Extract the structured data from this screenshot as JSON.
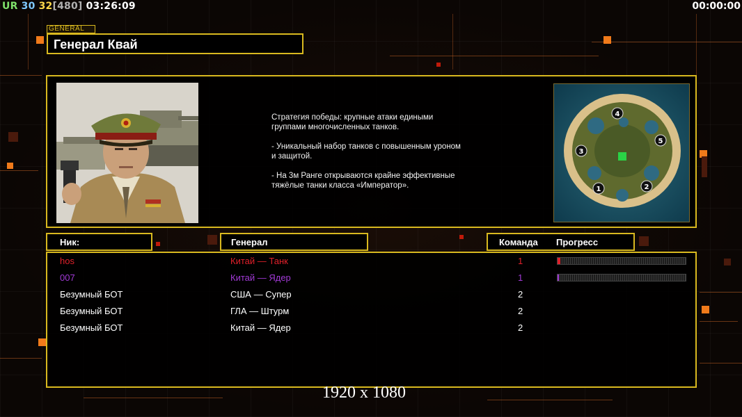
{
  "status": {
    "ur_label": "UR",
    "fps_a": "30",
    "fps_b": "32",
    "fps_c": "[480]",
    "clock": "03:26:09",
    "timer": "00:00:00"
  },
  "general": {
    "tag": "GENERAL",
    "name": "Генерал Квай"
  },
  "strategy": [
    "Стратегия победы: крупные атаки едиными\n группами многочисленных танков.",
    "- Уникальный набор танков с повышенным уроном\n и защитой.",
    "- На 3м Ранге открываются крайне эффективные\n тяжёлые танки класса «Император»."
  ],
  "columns": {
    "nick": "Ник:",
    "general": "Генерал",
    "team": "Команда",
    "progress": "Прогресс"
  },
  "players": [
    {
      "nick": "hos",
      "general": "Китай — Танк",
      "team": "1",
      "color": "#e0202a",
      "progress": 0.02
    },
    {
      "nick": "007",
      "general": "Китай — Ядер",
      "team": "1",
      "color": "#a23ad6",
      "progress": 0.01
    },
    {
      "nick": "Безумный БОТ",
      "general": "США — Супер",
      "team": "2",
      "color": "#ffffff",
      "progress": null
    },
    {
      "nick": "Безумный БОТ",
      "general": "ГЛА — Штурм",
      "team": "2",
      "color": "#ffffff",
      "progress": null
    },
    {
      "nick": "Безумный БОТ",
      "general": "Китай — Ядер",
      "team": "2",
      "color": "#ffffff",
      "progress": null
    }
  ],
  "map_slots": [
    "1",
    "2",
    "3",
    "4",
    "5"
  ],
  "resolution": "1920 x 1080",
  "colors": {
    "frame": "#d9b91f",
    "accent_orange": "#f07a1a"
  }
}
